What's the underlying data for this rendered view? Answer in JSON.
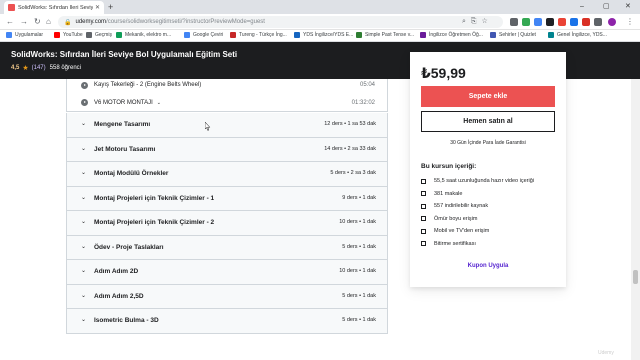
{
  "browser": {
    "tab_title": "SolidWorks: Sıfırdan İleri Seviye",
    "tab_close": "✕",
    "new_tab": "+",
    "url_host": "udemy.com",
    "url_path": "/course/solidworksegitimseti/?instructorPreviewMode=guest",
    "window_controls": [
      "–",
      "▢",
      "✕"
    ],
    "bookmarks": [
      {
        "label": "Uygulamalar",
        "color": "#4285f4"
      },
      {
        "label": "YouTube",
        "color": "#ff0000"
      },
      {
        "label": "Geçmiş",
        "color": "#5f6368"
      },
      {
        "label": "Mekanik, elektro m...",
        "color": "#0f9d58"
      },
      {
        "label": "Google Çeviri",
        "color": "#4285f4"
      },
      {
        "label": "Tureng - Türkçe İng...",
        "color": "#c62828"
      },
      {
        "label": "YDS İngilizce/YDS E...",
        "color": "#1565c0"
      },
      {
        "label": "Simple Past Tense v...",
        "color": "#2e7d32"
      },
      {
        "label": "İngilizce Öğretmen Öğ...",
        "color": "#6a1b9a"
      },
      {
        "label": "Sehirler | Quizlet",
        "color": "#4257b2"
      },
      {
        "label": "Genel İngilizce, YDS...",
        "color": "#00838f"
      }
    ]
  },
  "course": {
    "title": "SolidWorks: Sıfırdan İleri Seviye Bol Uygulamalı Eğitim Seti",
    "rating": "4,5",
    "star": "★",
    "rating_count": "(147)",
    "students": "558 öğrenci"
  },
  "curriculum": {
    "lectures": [
      {
        "title": "Kayış Tekerleği - 2 (Engine Belts Wheel)",
        "duration": "05:04",
        "has_chevron": false
      },
      {
        "title": "V6 MOTOR MONTAJI",
        "duration": "01:32:02",
        "has_chevron": true
      }
    ],
    "chevron": "⌄",
    "section_chevron": "⌄",
    "sections": [
      {
        "title": "Mengene Tasarımı",
        "meta": "12 ders • 1 sa 53 dak"
      },
      {
        "title": "Jet Motoru Tasarımı",
        "meta": "14 ders • 2 sa 33 dak"
      },
      {
        "title": "Montaj Modülü Örnekler",
        "meta": "5 ders • 2 sa 3 dak"
      },
      {
        "title": "Montaj Projeleri için Teknik Çizimler - 1",
        "meta": "9 ders • 1 dak"
      },
      {
        "title": "Montaj Projeleri için Teknik Çizimler - 2",
        "meta": "10 ders • 1 dak"
      },
      {
        "title": "Ödev - Proje Taslakları",
        "meta": "5 ders • 1 dak"
      },
      {
        "title": "Adım Adım 2D",
        "meta": "10 ders • 1 dak"
      },
      {
        "title": "Adım Adım 2,5D",
        "meta": "5 ders • 1 dak"
      },
      {
        "title": "Isometric Bulma - 3D",
        "meta": "5 ders • 1 dak"
      }
    ]
  },
  "purchase": {
    "price": "₺59,99",
    "add_to_cart": "Sepete ekle",
    "buy_now": "Hemen satın al",
    "guarantee": "30 Gün İçinde Para İade Garantisi",
    "includes_heading": "Bu kursun içeriği:",
    "includes": [
      {
        "text": "55,5 saat uzunluğunda hazır video içeriği",
        "icon": "video-icon"
      },
      {
        "text": "381 makale",
        "icon": "article-icon"
      },
      {
        "text": "557 indirilebilir kaynak",
        "icon": "download-icon"
      },
      {
        "text": "Ömür boyu erişim",
        "icon": "infinity-icon"
      },
      {
        "text": "Mobil ve TV'den erişim",
        "icon": "mobile-icon"
      },
      {
        "text": "Bitirme sertifikası",
        "icon": "certificate-icon"
      }
    ],
    "coupon": "Kupon Uygula"
  },
  "colors": {
    "accent_red": "#ec5252",
    "header_dark": "#1c1d1f",
    "link_purple": "#5624d0",
    "star_orange": "#e59819"
  },
  "watermark": "Udemy"
}
